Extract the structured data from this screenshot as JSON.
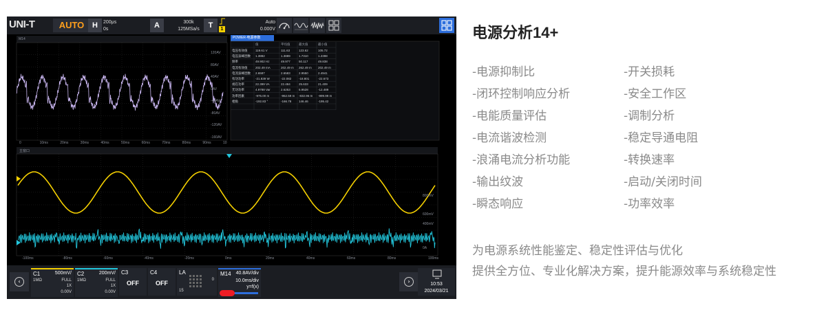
{
  "heading": "电源分析14+",
  "features_left": [
    "-电源抑制比",
    "-闭环控制响应分析",
    "-电能质量评估",
    "-电流谐波检测",
    "-浪涌电流分析功能",
    "-输出纹波",
    "-瞬态响应"
  ],
  "features_right": [
    "-开关损耗",
    "-安全工作区",
    "-调制分析",
    "-稳定导通电阻",
    "-转换速率",
    "-启动/关闭时间",
    "-功率效率"
  ],
  "description": [
    "为电源系统性能鉴定、稳定性评估与优化",
    "提供全方位、专业化解决方案，提升能源效率与系统稳定性"
  ],
  "scope": {
    "logo": "UNI-T",
    "mode": "AUTO",
    "horizontal": {
      "key": "H",
      "timebase": "200μs",
      "delay": "0s"
    },
    "acquire": {
      "key": "A",
      "points": "300k",
      "rate": "125MSa/s"
    },
    "trigger": {
      "key": "T",
      "source": "1",
      "mode": "Auto",
      "level": "0.000V"
    },
    "top_icons": [
      "gauge-icon",
      "sine-wave-icon",
      "noise-wave-icon",
      "grid-icon"
    ],
    "menu_icon": "menu-grid-icon",
    "math_window_label": "M14",
    "main_window_label": "主窗口",
    "math_y_ticks": [
      "120AV",
      "80AV",
      "40AV",
      "0AV",
      "-40AV",
      "-80AV",
      "-120AV",
      "-160AV"
    ],
    "math_x_ticks": [
      "0",
      "10ms",
      "20ms",
      "30ms",
      "40ms",
      "50ms",
      "60ms",
      "70ms",
      "80ms",
      "90ms",
      "10"
    ],
    "main_x_ticks": [
      "-100ms",
      "-80ms",
      "-60ms",
      "-40ms",
      "-20ms",
      "0ms",
      "20ms",
      "40ms",
      "60ms",
      "80ms",
      "100ms"
    ],
    "main_right_labels": [
      "800mV",
      "600mV",
      "400mV",
      "0A"
    ],
    "measure": {
      "header": "POWER-电源参数",
      "columns": [
        "",
        "值",
        "平均值",
        "最大值",
        "最小值"
      ],
      "rows": [
        [
          "电压有效值",
          "119.61 V",
          "111.63",
          "123.62",
          "105.72"
        ],
        [
          "电压波峰因数",
          "1.3882",
          "1.3889",
          "1.7310",
          "1.2398"
        ],
        [
          "频率",
          "49.902 Hz",
          "49.977",
          "50.117",
          "49.838"
        ],
        [
          "电流有效值",
          "202.49 mA",
          "202.49 m",
          "262.49 m",
          "202.49 m"
        ],
        [
          "电流波峰因数",
          "2.6587",
          "2.6583",
          "2.9550",
          "2.4941"
        ],
        [
          "有功功率",
          "-21.839 W",
          "-22.082",
          "-18.801",
          "-22.673"
        ],
        [
          "视在功率",
          "22.399 VA",
          "22.484",
          "25.633",
          "21.409"
        ],
        [
          "无功功率",
          "4.9788 Var",
          "2.6253",
          "5.9528",
          "-12.489"
        ],
        [
          "功率因素",
          "-975.00 m",
          "-962.59 m",
          "-832.96 m",
          "-999.99 m"
        ],
        [
          "相角",
          "-192.83 °",
          "-166.78",
          "146.46",
          "-195.42"
        ]
      ]
    },
    "channels": [
      {
        "name": "C1",
        "vdiv": "500mV/",
        "imp": "1MΩ",
        "bw": "FULL",
        "probe": "1X",
        "offset": "0.00V",
        "color": "#f5d000"
      },
      {
        "name": "C2",
        "vdiv": "200mV/",
        "imp": "1MΩ",
        "bw": "FULL",
        "probe": "1X",
        "offset": "0.00V",
        "color": "#22c7dd"
      },
      {
        "name": "C3",
        "state": "OFF"
      },
      {
        "name": "C4",
        "state": "OFF"
      }
    ],
    "la": {
      "name": "LA",
      "left": "15",
      "right": "0"
    },
    "math": {
      "name": "M14",
      "vdiv": "40.8AV/div",
      "hdiv": "10.0ms/div",
      "func": "y=f(x)"
    },
    "clock": {
      "time": "10:53",
      "date": "2024/03/21"
    },
    "colors": {
      "ch1": "#f5d000",
      "ch2": "#22c7dd",
      "math": "#c9b6f0",
      "accent": "#ff9f1c"
    }
  }
}
